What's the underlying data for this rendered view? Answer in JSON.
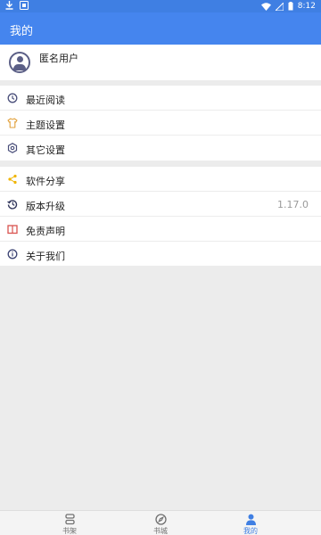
{
  "status_bar": {
    "time": "8:12",
    "icons": [
      "download-icon",
      "notification-icon",
      "wifi-icon",
      "signal-icon",
      "battery-icon"
    ]
  },
  "app_bar": {
    "title": "我的"
  },
  "profile": {
    "name": "匿名用户",
    "icon": "avatar-icon"
  },
  "menu_group_1": [
    {
      "label": "最近阅读",
      "icon": "clock-icon"
    },
    {
      "label": "主题设置",
      "icon": "shirt-icon"
    },
    {
      "label": "其它设置",
      "icon": "gear-icon"
    }
  ],
  "menu_group_2": [
    {
      "label": "软件分享",
      "icon": "share-icon"
    },
    {
      "label": "版本升级",
      "icon": "history-icon",
      "value": "1.17.0"
    },
    {
      "label": "免责声明",
      "icon": "book-icon"
    },
    {
      "label": "关于我们",
      "icon": "info-icon"
    }
  ],
  "bottom_nav": [
    {
      "label": "书架",
      "icon": "bookshelf-icon"
    },
    {
      "label": "书城",
      "icon": "compass-icon"
    },
    {
      "label": "我的",
      "icon": "person-icon",
      "active": true
    }
  ],
  "colors": {
    "primary": "#4585ee",
    "status_bar": "#3f7fe3",
    "active_tab": "#3f7fe3",
    "background": "#ececec"
  }
}
